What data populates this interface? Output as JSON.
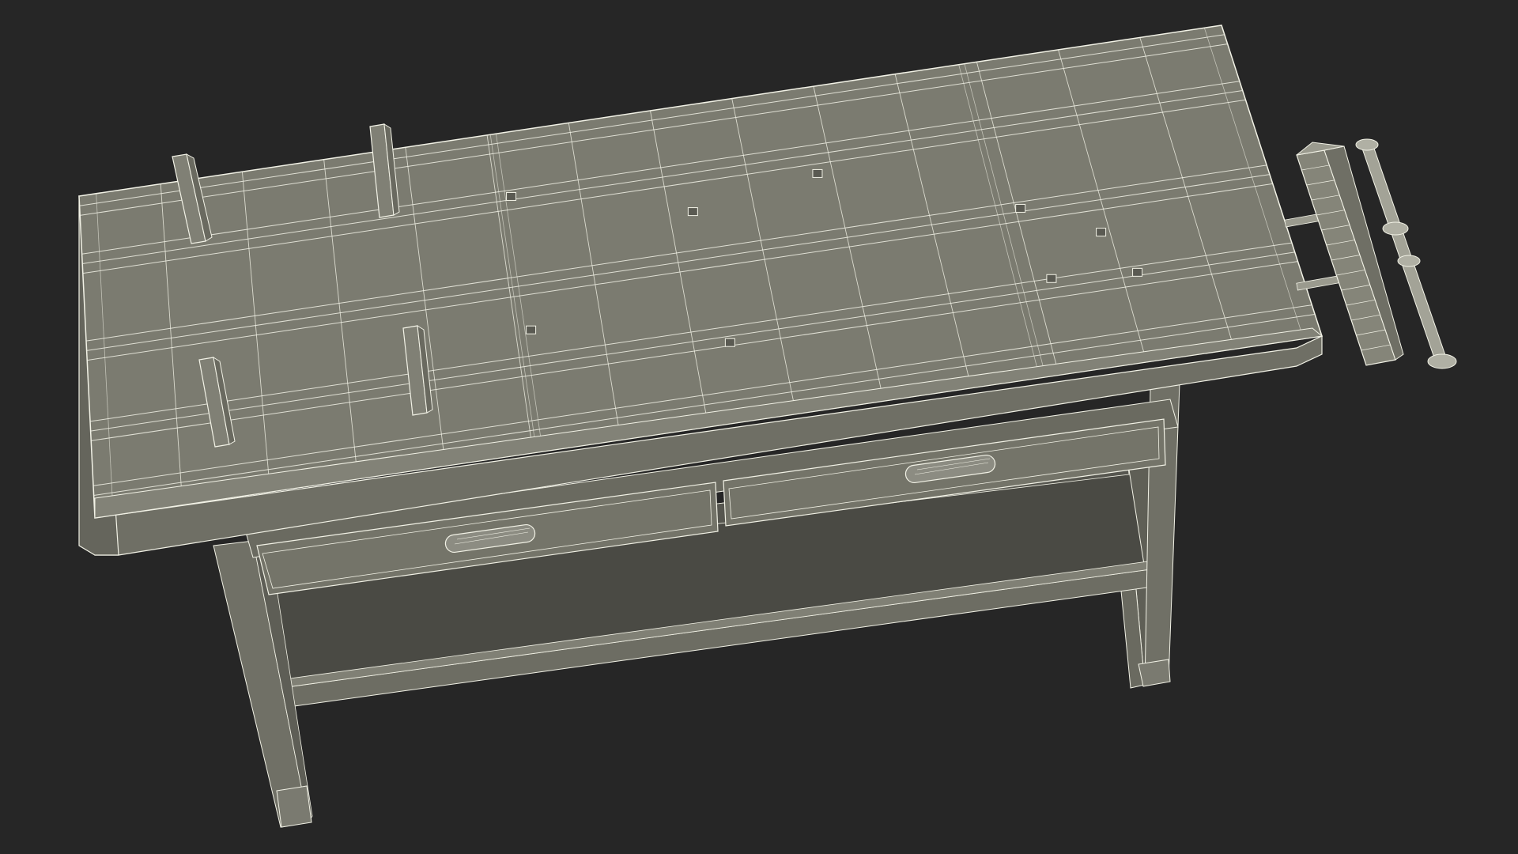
{
  "scene": {
    "subject": "workbench-wireframe-render",
    "colors": {
      "background": "#262626",
      "top_surface": "#7a7a6e",
      "top_edge": "#6c6c61",
      "front_face": "#717166",
      "shelf": "#4f4f48",
      "shelf_dark": "#3f3f3a",
      "leg": "#6e6e64",
      "vise": "#8a8a7e",
      "wire": "#f2f2e6"
    },
    "icons": {
      "vise_handle": "vise-handle-icon",
      "drawer_handle": "drawer-handle-icon",
      "bench_dog": "bench-dog-icon"
    }
  }
}
